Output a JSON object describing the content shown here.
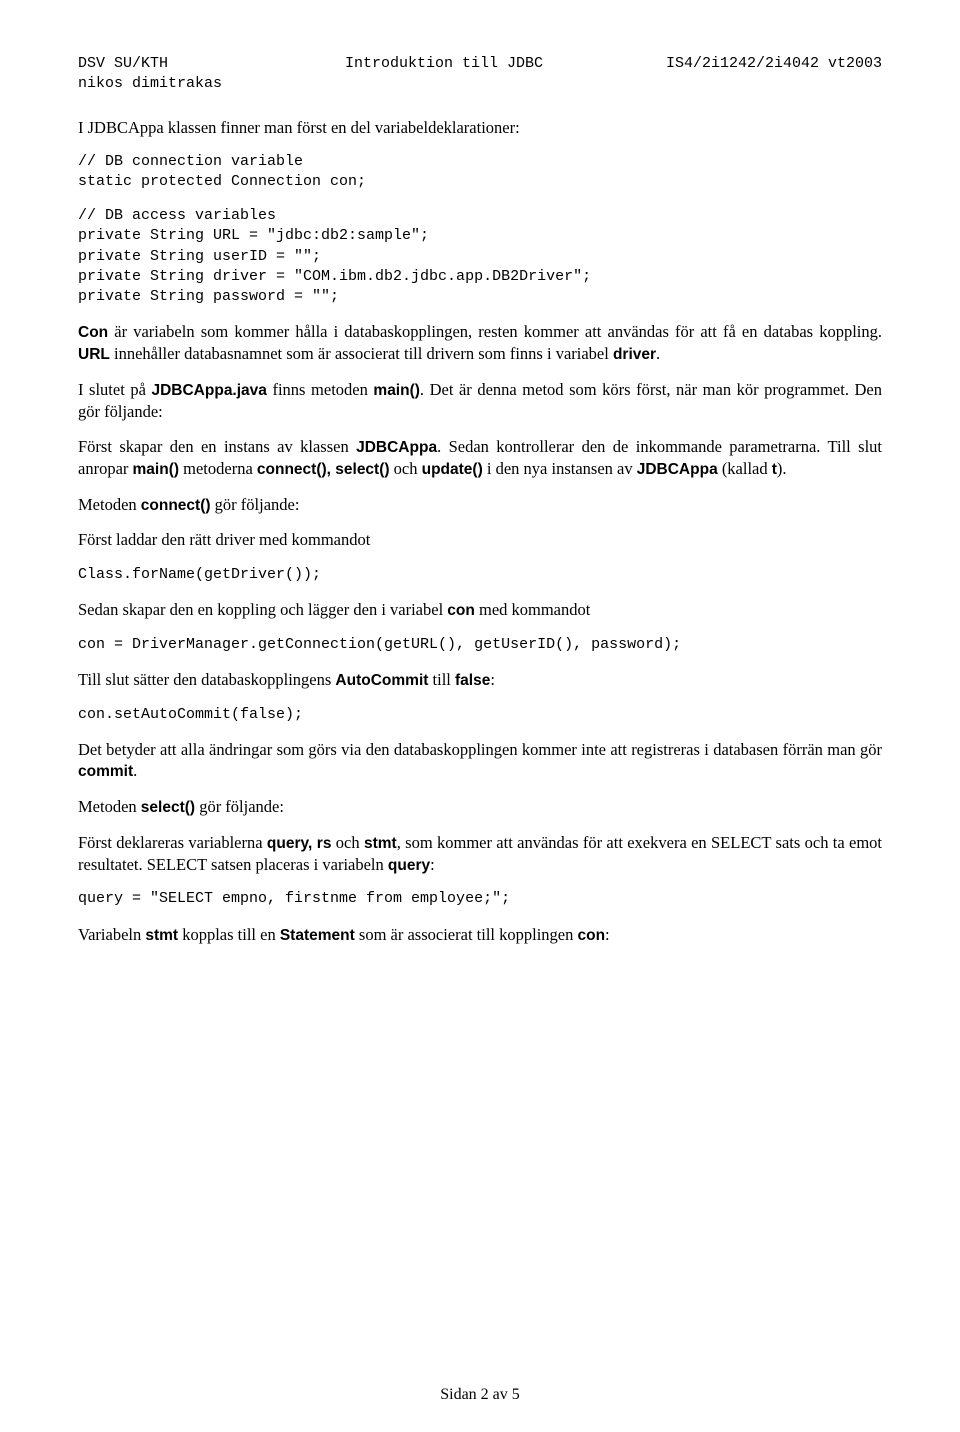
{
  "header": {
    "left_line1": "DSV SU/KTH",
    "left_line2": "nikos dimitrakas",
    "center": "Introduktion till JDBC",
    "right": "IS4/2i1242/2i4042 vt2003"
  },
  "code": {
    "block1": "// DB connection variable\nstatic protected Connection con;",
    "block2": "// DB access variables\nprivate String URL = \"jdbc:db2:sample\";\nprivate String userID = \"\";\nprivate String driver = \"COM.ibm.db2.jdbc.app.DB2Driver\";\nprivate String password = \"\";",
    "forName": "Class.forName(getDriver());",
    "getConn": "con = DriverManager.getConnection(getURL(), getUserID(), password);",
    "autoCommit": "con.setAutoCommit(false);",
    "query": "query = \"SELECT empno, firstnme from employee;\";"
  },
  "text": {
    "intro": "I JDBCAppa klassen finner man först en del variabeldeklarationer:",
    "p_con_1": "Con",
    "p_con_2": " är variabeln som kommer hålla i databaskopplingen, resten kommer att användas för att få en databas koppling. ",
    "p_con_3": "URL",
    "p_con_4": " innehåller databasnamnet som är associerat till drivern som finns i variabel ",
    "p_con_5": "driver",
    "p_con_6": ".",
    "p_main_1": "I slutet på ",
    "p_main_2": "JDBCAppa.java",
    "p_main_3": " finns metoden ",
    "p_main_4": "main()",
    "p_main_5": ". Det är denna metod som körs först, när man kör programmet. Den gör följande:",
    "p_inst_1": "Först skapar den en instans av klassen ",
    "p_inst_2": "JDBCAppa",
    "p_inst_3": ". Sedan kontrollerar den de inkommande parametrarna. Till slut anropar ",
    "p_inst_4": "main()",
    "p_inst_5": " metoderna ",
    "p_inst_6": "connect(), select()",
    "p_inst_7": " och ",
    "p_inst_8": "update()",
    "p_inst_9": " i den nya instansen av ",
    "p_inst_10": "JDBCAppa",
    "p_inst_11": " (kallad ",
    "p_inst_12": "t",
    "p_inst_13": ").",
    "p_connect_1": "Metoden ",
    "p_connect_2": "connect()",
    "p_connect_3": " gör följande:",
    "p_loaddrv": "Först laddar den rätt driver med kommandot",
    "p_coupling_1": "Sedan skapar den en koppling och lägger den i variabel ",
    "p_coupling_2": "con",
    "p_coupling_3": " med kommandot",
    "p_autocommit_1": "Till slut sätter den databaskopplingens ",
    "p_autocommit_2": "AutoCommit",
    "p_autocommit_3": " till ",
    "p_autocommit_4": "false",
    "p_autocommit_5": ":",
    "p_meaning_1": "Det betyder att alla ändringar som görs via den databaskopplingen kommer inte att registreras i databasen förrän man gör ",
    "p_meaning_2": "commit",
    "p_meaning_3": ".",
    "p_select_1": "Metoden ",
    "p_select_2": "select()",
    "p_select_3": " gör följande:",
    "p_decl_1": "Först deklareras variablerna ",
    "p_decl_2": "query, rs",
    "p_decl_3": " och ",
    "p_decl_4": "stmt",
    "p_decl_5": ", som kommer att användas för att exekvera en SELECT sats och ta emot resultatet. SELECT satsen placeras i variabeln ",
    "p_decl_6": "query",
    "p_decl_7": ":",
    "p_stmt_1": "Variabeln ",
    "p_stmt_2": "stmt",
    "p_stmt_3": " kopplas till en ",
    "p_stmt_4": "Statement",
    "p_stmt_5": " som är associerat till kopplingen ",
    "p_stmt_6": "con",
    "p_stmt_7": ":"
  },
  "footer": "Sidan 2 av 5"
}
